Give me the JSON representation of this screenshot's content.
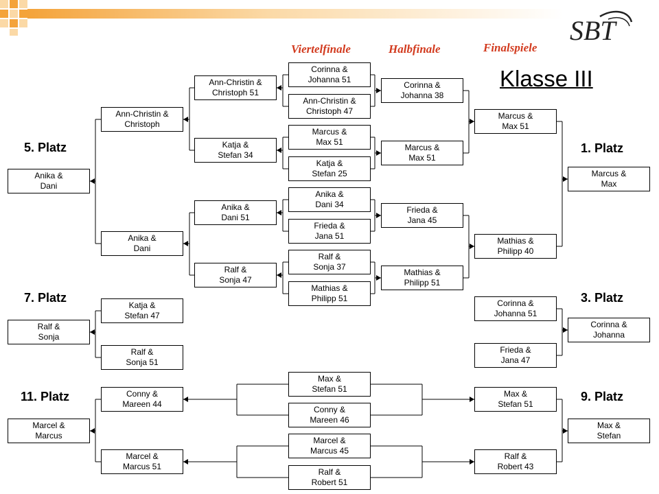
{
  "headers": {
    "viertelfinale": "Viertelfinale",
    "halbfinale": "Halbfinale",
    "finalspiele": "Finalspiele"
  },
  "class_title": "Klasse III",
  "logo_text": "SBT",
  "places": {
    "p5": "5. Platz",
    "p1": "1. Platz",
    "p7": "7. Platz",
    "p3": "3. Platz",
    "p11": "11. Platz",
    "p9": "9. Platz"
  },
  "colors": {
    "header_red": "#d23a1e",
    "deco_orange": "#f4a33a",
    "deco_light": "#fbd9a6"
  },
  "boxes": {
    "qf1": "Corinna &\nJohanna 51",
    "qf2": "Ann-Christin &\nChristoph 47",
    "qf3": "Marcus &\nMax 51",
    "qf4": "Katja &\nStefan 25",
    "qf5": "Anika &\nDani 34",
    "qf6": "Frieda &\nJana 51",
    "qf7": "Ralf &\nSonja 37",
    "qf8": "Mathias &\nPhilipp 51",
    "l1a": "Ann-Christin &\nChristoph 51",
    "l1b": "Katja &\nStefan 34",
    "l1c": "Anika &\nDani 51",
    "l1d": "Ralf &\nSonja 47",
    "l2a": "Ann-Christin &\nChristoph",
    "l2b": "Anika &\nDani",
    "p5w": "Anika &\nDani",
    "sf1": "Corinna &\nJohanna 38",
    "sf2": "Marcus &\nMax 51",
    "sf3": "Frieda &\nJana 45",
    "sf4": "Mathias &\nPhilipp 51",
    "f1": "Marcus &\nMax 51",
    "f2": "Mathias &\nPhilipp 40",
    "p1w": "Marcus &\nMax",
    "l7a": "Katja &\nStefan 47",
    "l7b": "Ralf &\nSonja 51",
    "p7w": "Ralf &\nSonja",
    "r3a": "Corinna &\nJohanna 51",
    "r3b": "Frieda &\nJana 47",
    "p3w": "Corinna &\nJohanna",
    "c1": "Max &\nStefan 51",
    "c2": "Conny &\nMareen 46",
    "c3": "Marcel &\nMarcus 45",
    "c4": "Ralf &\nRobert 51",
    "l11a": "Conny &\nMareen 44",
    "l11b": "Marcel &\nMarcus 51",
    "p11w": "Marcel &\nMarcus",
    "r9a": "Max &\nStefan 51",
    "r9b": "Ralf &\nRobert 43",
    "p9w": "Max &\nStefan"
  }
}
